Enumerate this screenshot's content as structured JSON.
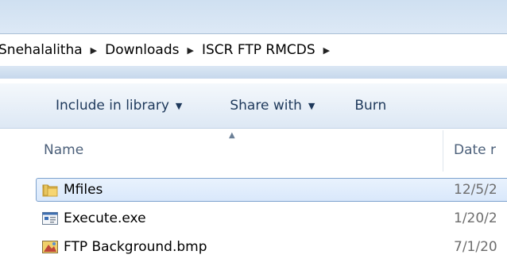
{
  "breadcrumb": {
    "items": [
      "Snehalalitha",
      "Downloads",
      "ISCR FTP RMCDS"
    ],
    "separator": "▶"
  },
  "toolbar": {
    "include_label": "Include in library",
    "share_label": "Share with",
    "burn_label": "Burn",
    "dropdown_arrow": "▼"
  },
  "columns": {
    "name": "Name",
    "date": "Date r",
    "sort_indicator": "▲"
  },
  "files": [
    {
      "name": "Mfiles",
      "date": "12/5/2",
      "icon": "folder-icon",
      "selected": true
    },
    {
      "name": "Execute.exe",
      "date": "1/20/2",
      "icon": "exe-icon",
      "selected": false
    },
    {
      "name": "FTP Background.bmp",
      "date": "7/1/20",
      "icon": "bmp-icon",
      "selected": false
    }
  ],
  "colors": {
    "toolbar_text": "#1e395b",
    "selection_border": "#7da2ce",
    "selection_fill": "#d9e8fb",
    "header_text": "#4c607a"
  }
}
